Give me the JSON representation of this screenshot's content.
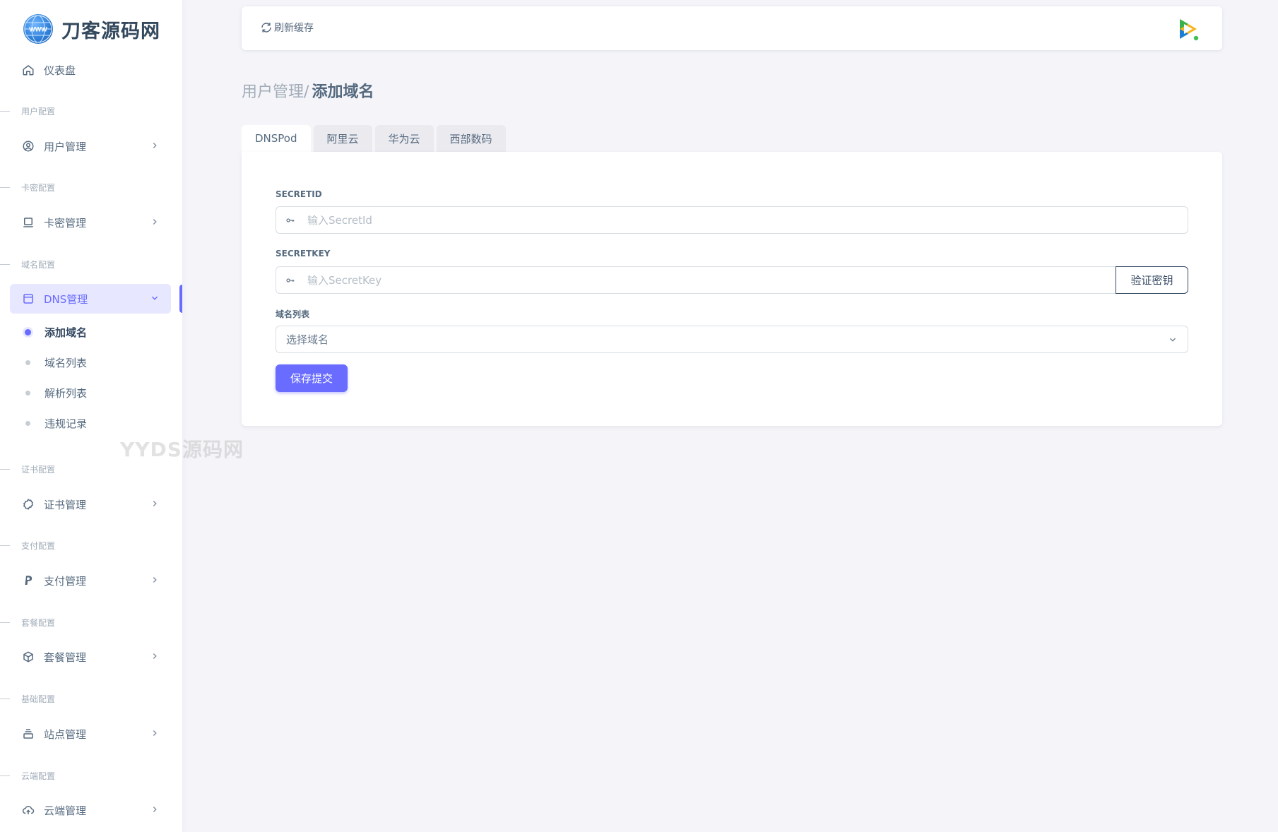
{
  "brand": {
    "name": "刀客源码网",
    "logo_text": "WWW"
  },
  "sidebar": {
    "dashboard": "仪表盘",
    "sections": [
      {
        "header": "用户配置",
        "item": "用户管理"
      },
      {
        "header": "卡密配置",
        "item": "卡密管理"
      },
      {
        "header": "域名配置",
        "item": "DNS管理"
      },
      {
        "header": "证书配置",
        "item": "证书管理"
      },
      {
        "header": "支付配置",
        "item": "支付管理"
      },
      {
        "header": "套餐配置",
        "item": "套餐管理"
      },
      {
        "header": "基础配置",
        "item": "站点管理"
      },
      {
        "header": "云端配置",
        "item": "云端管理"
      }
    ],
    "dns_sub": [
      "添加域名",
      "域名列表",
      "解析列表",
      "违规记录"
    ]
  },
  "watermark": "YYDS源码网",
  "navbar": {
    "refresh_label": "刷新缓存"
  },
  "breadcrumb": {
    "parent": "用户管理",
    "separator": "/",
    "current": "添加域名"
  },
  "tabs": [
    "DNSPod",
    "阿里云",
    "华为云",
    "西部数码"
  ],
  "form": {
    "secretid_label": "SECRETID",
    "secretid_placeholder": "输入SecretId",
    "secretkey_label": "SECRETKEY",
    "secretkey_placeholder": "输入SecretKey",
    "verify_label": "验证密钥",
    "domain_list_label": "域名列表",
    "domain_select_value": "选择域名",
    "submit_label": "保存提交"
  },
  "colors": {
    "primary": "#696cff",
    "active_bg": "#e7e7ff",
    "page_bg": "#f5f5f9"
  }
}
